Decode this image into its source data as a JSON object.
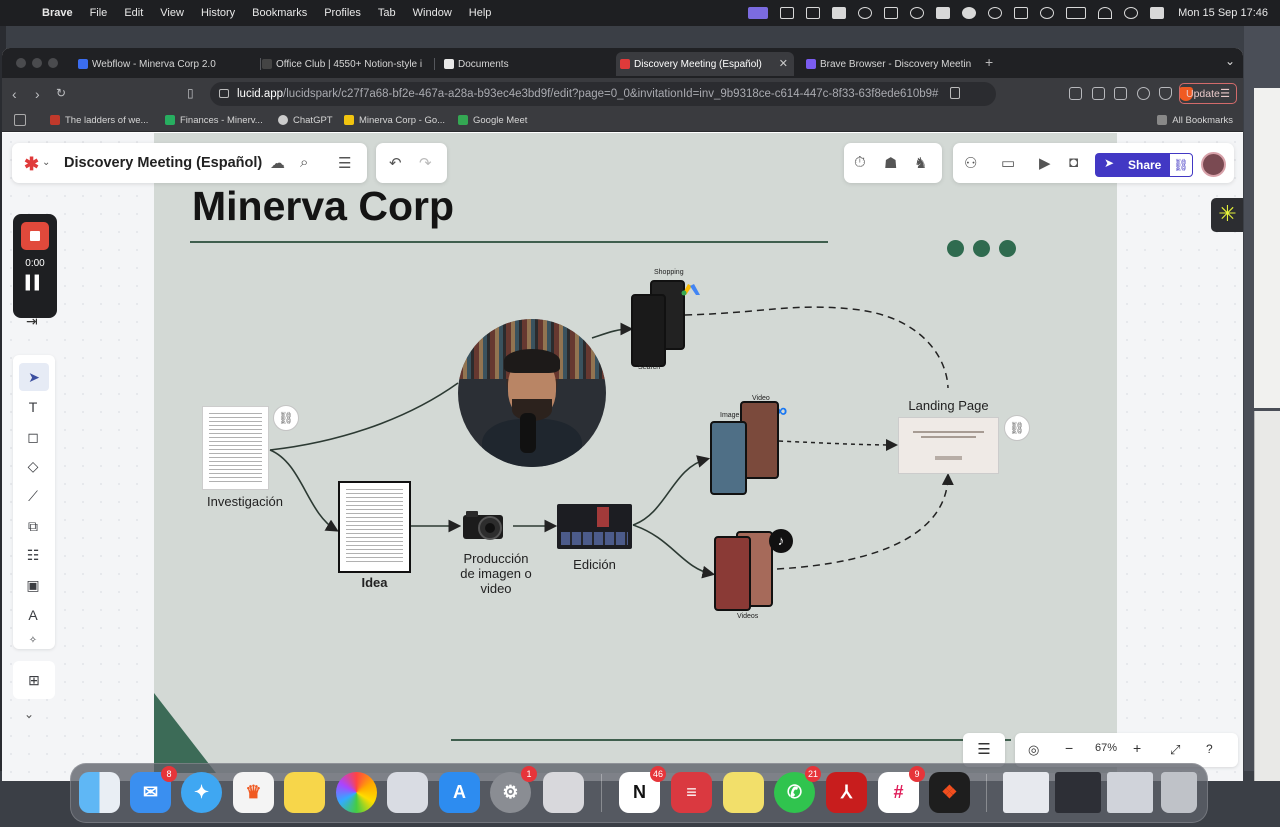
{
  "menubar": {
    "app_name": "Brave",
    "items": [
      "File",
      "Edit",
      "View",
      "History",
      "Bookmarks",
      "Profiles",
      "Tab",
      "Window",
      "Help"
    ],
    "datetime": "Mon 15 Sep  17:46"
  },
  "tabs": [
    {
      "title": "Webflow - Minerva Corp 2.0",
      "color": "#3b6df0"
    },
    {
      "title": "Office Club | 4550+ Notion-style i",
      "color": "#444444"
    },
    {
      "title": "Documents",
      "color": "#e8e8e8"
    },
    {
      "title": "Discovery Meeting (Español) ",
      "color": "#e03a3a",
      "active": true
    },
    {
      "title": "Brave Browser - Discovery Meetin",
      "color": "#7a5cf0"
    }
  ],
  "address": {
    "host": "lucid.app",
    "path": "/lucidspark/c27f7a68-bf2e-467a-a28a-b93ec4e3bd9f/edit?page=0_0&invitationId=inv_9b9318ce-c614-447c-8f33-63f8ede610b9#",
    "update_label": "Update"
  },
  "bookmarks": [
    {
      "label": "The ladders of we...",
      "color": "#c0392b"
    },
    {
      "label": "Finances - Minerv...",
      "color": "#27ae60"
    },
    {
      "label": "ChatGPT",
      "color": "#cccccc"
    },
    {
      "label": "Minerva Corp - Go...",
      "color": "#f1c40f"
    },
    {
      "label": "Google Meet",
      "color": "#34a853"
    }
  ],
  "all_bookmarks_label": "All Bookmarks",
  "lucid": {
    "doc_title": "Discovery Meeting (Español)",
    "share_label": "Share",
    "recorder_time": "0:00",
    "zoom_label": "67%"
  },
  "board": {
    "title": "Minerva Corp",
    "labels": {
      "investigacion": "Investigación",
      "idea": "Idea",
      "produccion_1": "Producción",
      "produccion_2": "de imagen o",
      "produccion_3": "video",
      "edicion": "Edición",
      "landing": "Landing Page",
      "shopping": "Shopping",
      "search": "Search",
      "video": "Video",
      "image": "Image",
      "videos": "Videos"
    }
  },
  "dock": [
    {
      "name": "finder-icon",
      "bg": "#4aa3f0"
    },
    {
      "name": "mail-icon",
      "bg": "#3a8ff0",
      "badge": "8"
    },
    {
      "name": "safari-icon",
      "bg": "#3fa7f2"
    },
    {
      "name": "brave-icon",
      "bg": "#f4f4f4"
    },
    {
      "name": "notes-icon",
      "bg": "#f7d64a"
    },
    {
      "name": "photos-icon",
      "bg": "#ffffff"
    },
    {
      "name": "launchpad-icon",
      "bg": "#d9dce3"
    },
    {
      "name": "app-store-icon",
      "bg": "#2d8cf0"
    },
    {
      "name": "system-settings-icon",
      "bg": "#8a8d93",
      "badge": "1"
    },
    {
      "name": "iphone-mirroring-icon",
      "bg": "#d8d8dc"
    },
    {
      "name": "notion-icon",
      "bg": "#ffffff",
      "badge": "46"
    },
    {
      "name": "expressvpn-icon",
      "bg": "#da3940"
    },
    {
      "name": "stickies-icon",
      "bg": "#f2df6a"
    },
    {
      "name": "whatsapp-icon",
      "bg": "#30c44e",
      "badge": "21"
    },
    {
      "name": "acrobat-icon",
      "bg": "#c81d1d"
    },
    {
      "name": "slack-icon",
      "bg": "#ffffff",
      "badge": "9"
    },
    {
      "name": "figma-icon",
      "bg": "#1e1e1e"
    }
  ]
}
